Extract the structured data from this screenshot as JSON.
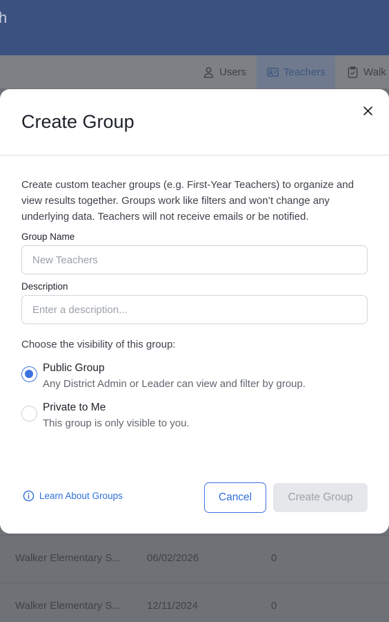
{
  "app": {
    "title_fragment": "h"
  },
  "background_tabs": [
    {
      "label": "Users",
      "icon": "user-icon"
    },
    {
      "label": "Teachers",
      "icon": "id-card-icon",
      "active": true
    },
    {
      "label": "Walk",
      "icon": "clipboard-icon"
    }
  ],
  "background_rows": [
    {
      "school": "Walker Elementary S...",
      "date": "06/02/2026",
      "count": "0"
    },
    {
      "school": "Walker Elementary S...",
      "date": "12/11/2024",
      "count": "0"
    }
  ],
  "modal": {
    "title": "Create Group",
    "close_icon": "close-icon",
    "intro": "Create custom teacher groups (e.g. First-Year Teachers) to organize and view results together. Groups work like filters and won’t change any underlying data. Teachers will not receive emails or be notified.",
    "group_name": {
      "label": "Group Name",
      "value": "",
      "placeholder": "New Teachers"
    },
    "description": {
      "label": "Description",
      "value": "",
      "placeholder": "Enter a description..."
    },
    "visibility_question": "Choose the visibility of this group:",
    "options": [
      {
        "title": "Public Group",
        "description": "Any District Admin or Leader can view and filter by group.",
        "selected": true
      },
      {
        "title": "Private to Me",
        "description": "This group is only visible to you.",
        "selected": false
      }
    ],
    "learn_link": "Learn About Groups",
    "learn_icon": "info-icon",
    "cancel_label": "Cancel",
    "create_label": "Create Group",
    "create_disabled": true
  },
  "colors": {
    "accent": "#3d73e0",
    "header_bg": "#3b5280",
    "overlay": "#6e7176",
    "disabled_bg": "#e5e7ea"
  }
}
